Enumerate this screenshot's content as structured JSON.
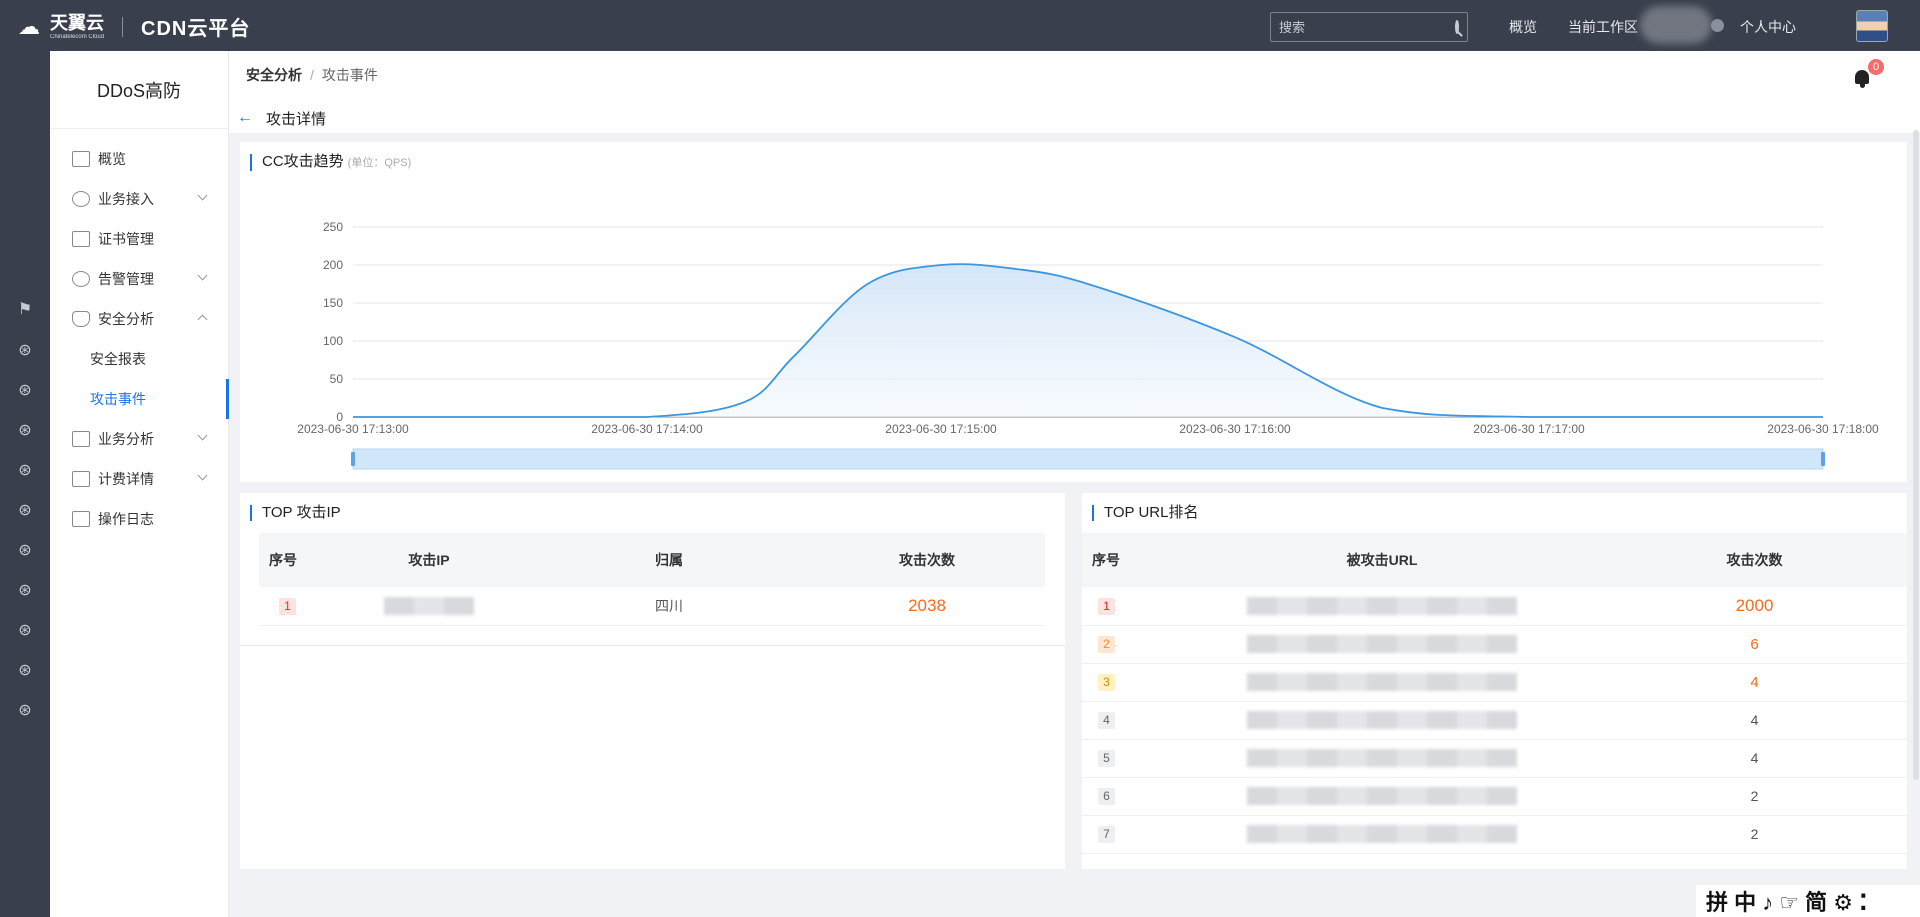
{
  "topbar": {
    "logo_main": "天翼云",
    "logo_sub": "Chinatelecom Cloud",
    "product": "CDN云平台",
    "search_placeholder": "搜索",
    "links": {
      "overview": "概览",
      "workspace": "当前工作区",
      "profile": "个人中心"
    }
  },
  "sidebar": {
    "title": "DDoS高防",
    "items": [
      {
        "label": "概览"
      },
      {
        "label": "业务接入"
      },
      {
        "label": "证书管理"
      },
      {
        "label": "告警管理"
      },
      {
        "label": "安全分析"
      }
    ],
    "sub_items": [
      {
        "label": "安全报表"
      },
      {
        "label": "攻击事件"
      }
    ],
    "items_after": [
      {
        "label": "业务分析"
      },
      {
        "label": "计费详情"
      },
      {
        "label": "操作日志"
      }
    ]
  },
  "breadcrumb": {
    "parent": "安全分析",
    "current": "攻击事件"
  },
  "page_title": "攻击详情",
  "notifications": {
    "count": "0"
  },
  "chart_data": {
    "type": "area",
    "title": "CC攻击趋势",
    "unit_label": "(单位：QPS)",
    "x": [
      "2023-06-30 17:13:00",
      "2023-06-30 17:13:30",
      "2023-06-30 17:14:00",
      "2023-06-30 17:14:20",
      "2023-06-30 17:14:30",
      "2023-06-30 17:14:45",
      "2023-06-30 17:15:00",
      "2023-06-30 17:15:15",
      "2023-06-30 17:15:30",
      "2023-06-30 17:16:00",
      "2023-06-30 17:16:30",
      "2023-06-30 17:17:00",
      "2023-06-30 17:18:00"
    ],
    "x_ticks": [
      "2023-06-30 17:13:00",
      "2023-06-30 17:14:00",
      "2023-06-30 17:15:00",
      "2023-06-30 17:16:00",
      "2023-06-30 17:17:00",
      "2023-06-30 17:18:00"
    ],
    "values": [
      0,
      0,
      0,
      20,
      80,
      175,
      200,
      195,
      175,
      105,
      12,
      0,
      0
    ],
    "y_ticks": [
      0,
      50,
      100,
      150,
      200,
      250
    ],
    "ylim": [
      0,
      250
    ],
    "grid": true,
    "color": "#3a96e0"
  },
  "top_ip": {
    "title": "TOP   攻击IP",
    "headers": [
      "序号",
      "攻击IP",
      "归属",
      "攻击次数"
    ],
    "rows": [
      {
        "rank": "1",
        "region": "四川",
        "count": "2038"
      }
    ]
  },
  "top_url": {
    "title": "TOP   URL排名",
    "headers": [
      "序号",
      "被攻击URL",
      "攻击次数"
    ],
    "rows": [
      {
        "rank": "1",
        "count": "2000"
      },
      {
        "rank": "2",
        "count": "6"
      },
      {
        "rank": "3",
        "count": "4"
      },
      {
        "rank": "4",
        "count": "4"
      },
      {
        "rank": "5",
        "count": "4"
      },
      {
        "rank": "6",
        "count": "2"
      },
      {
        "rank": "7",
        "count": "2"
      }
    ]
  },
  "ime": {
    "label": "拼 中 ♪ ☞ 简 ⚙ ⁚"
  }
}
